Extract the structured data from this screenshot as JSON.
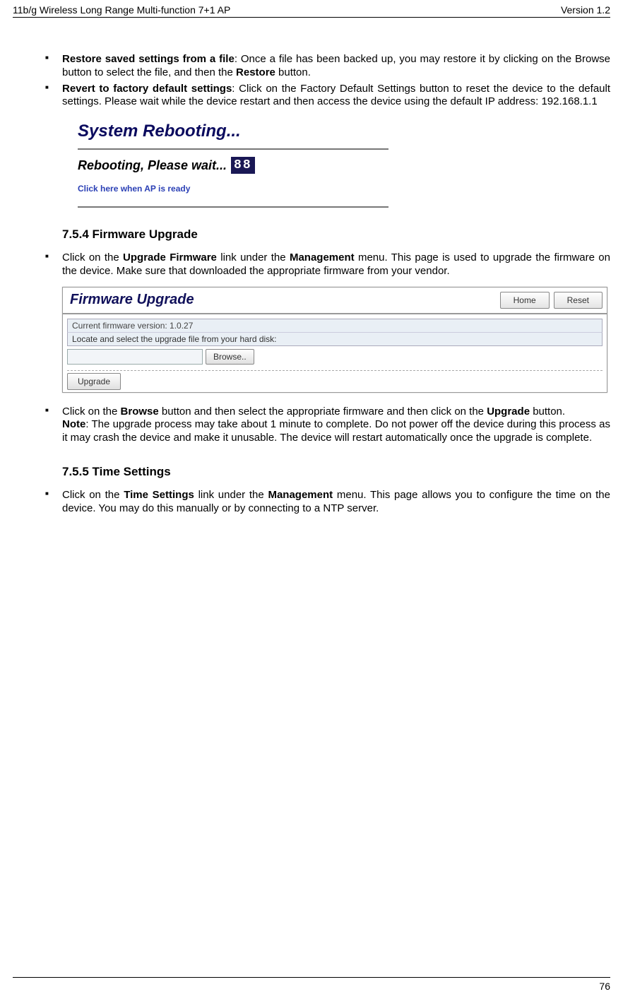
{
  "header": {
    "left": "11b/g Wireless Long Range Multi-function 7+1 AP",
    "right": "Version 1.2"
  },
  "footer": {
    "page": "76"
  },
  "bullets1": [
    {
      "bold1": "Restore saved settings from a file",
      "text1": ": Once a file has been backed up, you may restore it by clicking on the Browse button to select the file, and then the ",
      "bold2": "Restore",
      "text2": " button."
    },
    {
      "bold1": "Revert to factory default settings",
      "text1": ": Click on the Factory Default Settings button to reset the device to the default settings. Please wait while the device restart and then access the device using the default IP address: 192.168.1.1"
    }
  ],
  "reboot": {
    "title": "System Rebooting...",
    "wait": "Rebooting, Please wait...",
    "counter": "88",
    "ready": "Click here when AP is ready"
  },
  "section754": "7.5.4   Firmware Upgrade",
  "bullets2": [
    {
      "text_pre": "Click on the ",
      "b1": "Upgrade Firmware",
      "text_mid": " link under the ",
      "b2": "Management",
      "text_post": " menu. This page is used to upgrade the firmware on the device. Make sure that downloaded the appropriate firmware from your vendor."
    }
  ],
  "fw": {
    "title": "Firmware Upgrade",
    "home": "Home",
    "reset": "Reset",
    "current": "Current firmware version: 1.0.27",
    "locate": "Locate and select the upgrade file from your hard disk:",
    "browse": "Browse..",
    "upgrade": "Upgrade"
  },
  "bullets3": [
    {
      "pre": "Click on the ",
      "b1": "Browse",
      "mid": " button and then select the appropriate firmware and then click on the ",
      "b2": "Upgrade",
      "post": " button.",
      "note_b": "Note",
      "note": ": The upgrade process may take about 1 minute to complete. Do not power off the device during this process as it may crash the device and make it unusable. The device will restart automatically once the upgrade is complete."
    }
  ],
  "section755": "7.5.5   Time Settings",
  "bullets4": [
    {
      "pre": "Click on the ",
      "b1": "Time Settings",
      "mid": " link under the ",
      "b2": "Management",
      "post": " menu. This page allows you to configure the time on the device. You may do this manually or by connecting to a NTP server."
    }
  ]
}
